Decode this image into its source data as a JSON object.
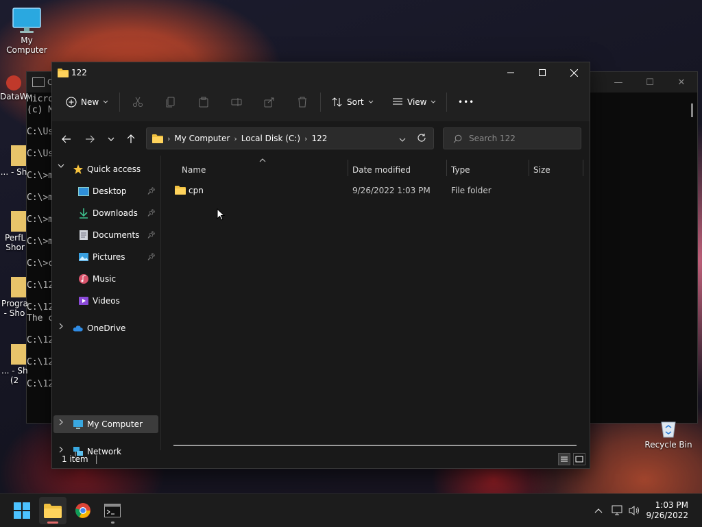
{
  "desktop": {
    "icons": [
      {
        "label": "My Computer"
      },
      {
        "label": "DataW"
      },
      {
        "label": "... - Sh"
      },
      {
        "label": "PerfL\nShor"
      },
      {
        "label": "Progra\n- Sho"
      },
      {
        "label": "... - Sh\n(2"
      },
      {
        "label": "Recycle Bin"
      }
    ]
  },
  "cmd": {
    "title": "C:",
    "lines": [
      "Micro",
      "(c) M",
      "",
      "C:\\Us",
      "",
      "C:\\Us",
      "",
      "C:\\>m",
      "",
      "C:\\>m",
      "",
      "C:\\>m",
      "",
      "C:\\>m",
      "",
      "C:\\>c",
      "",
      "C:\\12",
      "",
      "C:\\12",
      "The c",
      "",
      "C:\\12",
      "",
      "C:\\12",
      "",
      "C:\\12"
    ]
  },
  "explorer": {
    "title": "122",
    "toolbar": {
      "new_label": "New",
      "sort_label": "Sort",
      "view_label": "View",
      "more_label": "•••"
    },
    "address": {
      "crumbs": [
        "My Computer",
        "Local Disk (C:)",
        "122"
      ]
    },
    "search": {
      "placeholder": "Search 122"
    },
    "sidebar": {
      "quick_access": "Quick access",
      "items": [
        {
          "label": "Desktop",
          "pinned": true
        },
        {
          "label": "Downloads",
          "pinned": true
        },
        {
          "label": "Documents",
          "pinned": true
        },
        {
          "label": "Pictures",
          "pinned": true
        },
        {
          "label": "Music",
          "pinned": false
        },
        {
          "label": "Videos",
          "pinned": false
        }
      ],
      "onedrive": "OneDrive",
      "my_computer": "My Computer",
      "network": "Network"
    },
    "columns": {
      "name": "Name",
      "date": "Date modified",
      "type": "Type",
      "size": "Size"
    },
    "files": [
      {
        "name": "cpn",
        "date": "9/26/2022 1:03 PM",
        "type": "File folder",
        "size": ""
      }
    ],
    "status": {
      "count": "1 item"
    }
  },
  "taskbar": {
    "time": "1:03 PM",
    "date": "9/26/2022"
  },
  "colors": {
    "accent": "#4cc2ff",
    "folder": "#f0c040",
    "selected": "#3c3c3c"
  }
}
